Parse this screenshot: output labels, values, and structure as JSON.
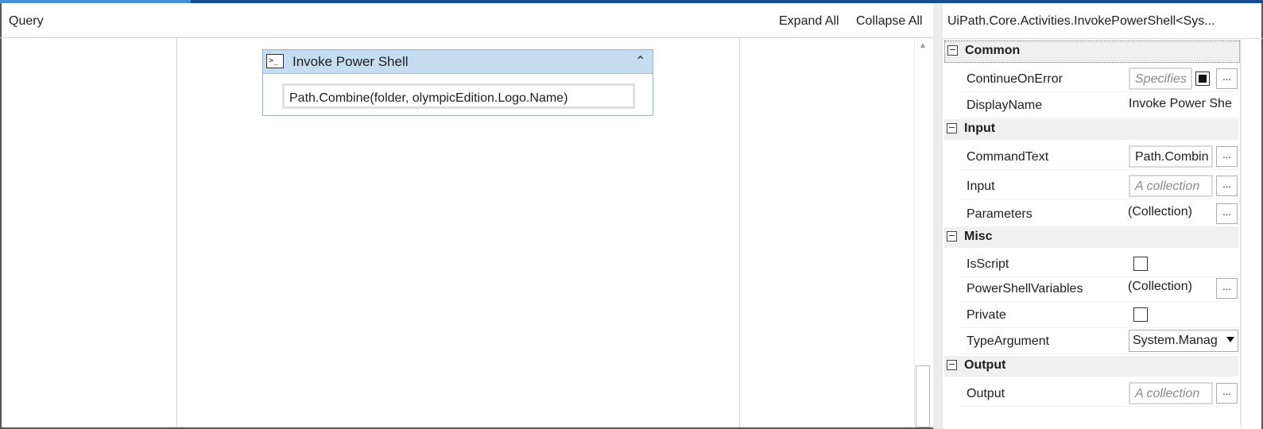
{
  "designer": {
    "query_label": "Query",
    "expand_all": "Expand All",
    "collapse_all": "Collapse All",
    "activity": {
      "title": "Invoke Power Shell",
      "icon_glyph": ">_",
      "command_text": "Path.Combine(folder, olympicEdition.Logo.Name)"
    }
  },
  "properties": {
    "title": "UiPath.Core.Activities.InvokePowerShell<Sys...",
    "categories": {
      "common": {
        "label": "Common",
        "toggle": "−",
        "continue_on_error": {
          "name": "ContinueOnError",
          "placeholder": "Specifies",
          "button": "..."
        },
        "display_name": {
          "name": "DisplayName",
          "value": "Invoke Power She"
        }
      },
      "input": {
        "label": "Input",
        "toggle": "−",
        "command_text": {
          "name": "CommandText",
          "value": "Path.Combin",
          "button": "..."
        },
        "input": {
          "name": "Input",
          "placeholder": "A collection",
          "button": "..."
        },
        "parameters": {
          "name": "Parameters",
          "value": "(Collection)",
          "button": "..."
        }
      },
      "misc": {
        "label": "Misc",
        "toggle": "−",
        "is_script": {
          "name": "IsScript",
          "checked": false
        },
        "powershell_variables": {
          "name": "PowerShellVariables",
          "value": "(Collection)",
          "button": "..."
        },
        "private": {
          "name": "Private",
          "checked": false
        },
        "type_argument": {
          "name": "TypeArgument",
          "value": "System.Manag"
        }
      },
      "output": {
        "label": "Output",
        "toggle": "−",
        "output": {
          "name": "Output",
          "placeholder": "A collection",
          "button": "..."
        }
      }
    }
  }
}
